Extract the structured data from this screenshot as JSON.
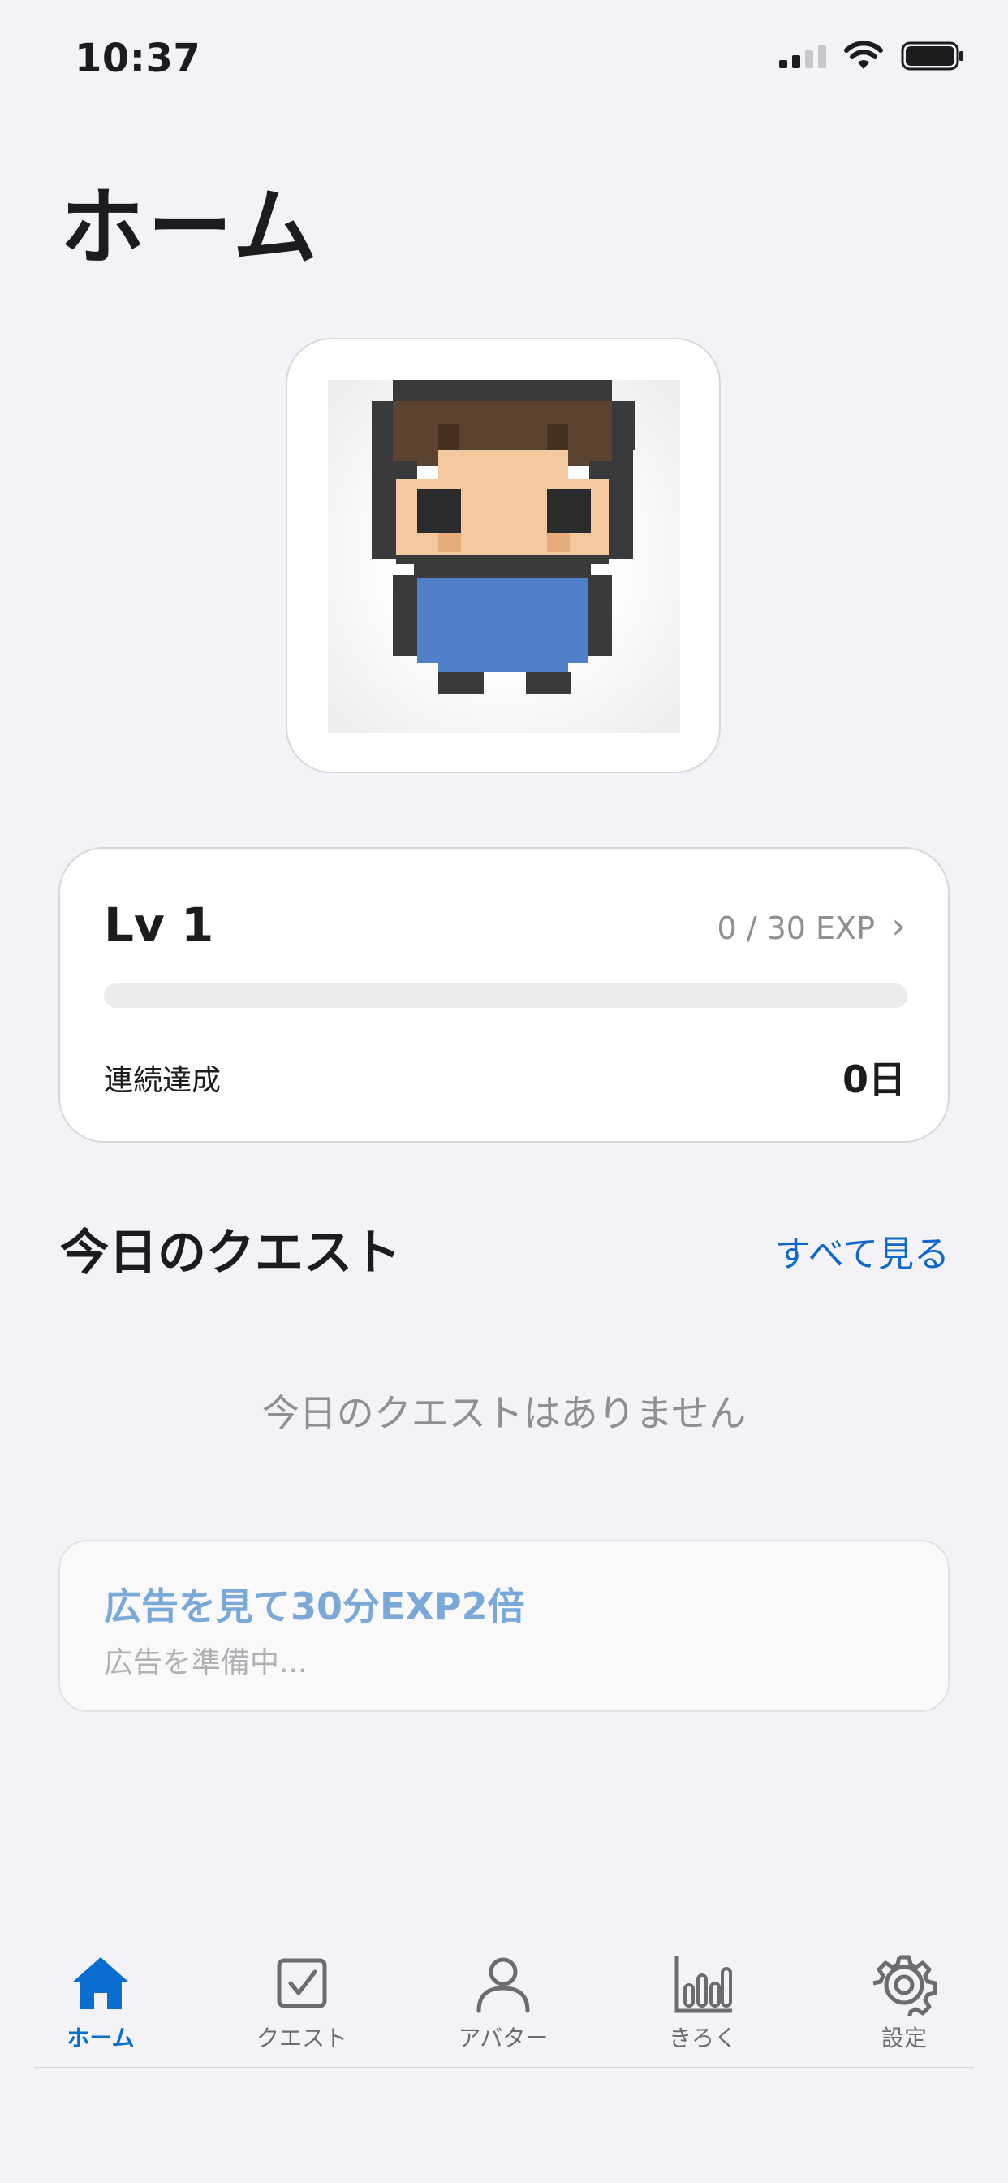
{
  "status_bar": {
    "time": "10:37"
  },
  "header": {
    "title": "ホーム"
  },
  "level_card": {
    "level_label": "Lv 1",
    "exp_text": "0 / 30 EXP",
    "exp_progress": 0,
    "streak_label": "連続達成",
    "streak_value": "0日"
  },
  "quests": {
    "section_title": "今日のクエスト",
    "see_all_label": "すべて見る",
    "empty_message": "今日のクエストはありません"
  },
  "ad_card": {
    "title": "広告を見て30分EXP2倍",
    "subtitle": "広告を準備中..."
  },
  "tab_bar": {
    "tabs": [
      {
        "label": "ホーム",
        "icon": "house-icon",
        "active": true
      },
      {
        "label": "クエスト",
        "icon": "checkbox-icon",
        "active": false
      },
      {
        "label": "アバター",
        "icon": "person-icon",
        "active": false
      },
      {
        "label": "きろく",
        "icon": "bar-chart-icon",
        "active": false
      },
      {
        "label": "設定",
        "icon": "gear-icon",
        "active": false
      }
    ]
  },
  "colors": {
    "accent": "#0a6ed1",
    "background": "#f2f2f7",
    "hair": "#5c4330",
    "skin": "#f4c9a0",
    "outfit": "#4f7fc6"
  }
}
